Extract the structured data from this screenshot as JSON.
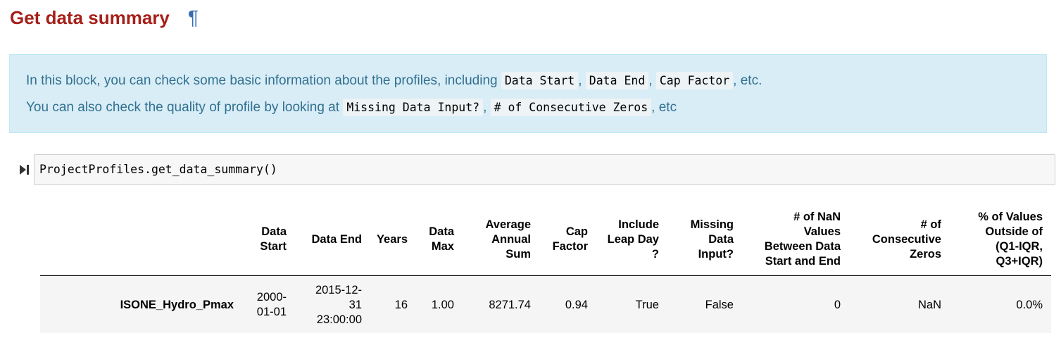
{
  "heading": {
    "title": "Get data summary",
    "anchor": "¶"
  },
  "info": {
    "line1_prefix": "In this block, you can check some basic information about the profiles, including",
    "line1_code1": "Data Start",
    "line1_sep1": ",",
    "line1_code2": "Data End",
    "line1_sep2": ",",
    "line1_code3": "Cap Factor",
    "line1_suffix": ", etc.",
    "line2_prefix": "You can also check the quality of profile by looking at",
    "line2_code1": "Missing Data Input?",
    "line2_sep1": ",",
    "line2_code2": "# of Consecutive Zeros",
    "line2_suffix": ", etc"
  },
  "cell": {
    "code": "ProjectProfiles.get_data_summary()"
  },
  "table": {
    "headers": {
      "data_start": [
        "Data",
        "Start"
      ],
      "data_end": [
        "Data End"
      ],
      "years": [
        "Years"
      ],
      "data_max": [
        "Data",
        "Max"
      ],
      "avg_annual_sum": [
        "Average",
        "Annual",
        "Sum"
      ],
      "cap_factor": [
        "Cap",
        "Factor"
      ],
      "include_leap_day": [
        "Include",
        "Leap Day",
        "?"
      ],
      "missing_data_input": [
        "Missing",
        "Data",
        "Input?"
      ],
      "nan_values": [
        "# of NaN",
        "Values",
        "Between Data",
        "Start and End"
      ],
      "consecutive_zeros": [
        "# of",
        "Consecutive",
        "Zeros"
      ],
      "pct_outside": [
        "% of Values",
        "Outside of",
        "(Q1-IQR,",
        "Q3+IQR)"
      ]
    },
    "row": {
      "index": "ISONE_Hydro_Pmax",
      "data_start": [
        "2000-",
        "01-01"
      ],
      "data_end": [
        "2015-12-",
        "31",
        "23:00:00"
      ],
      "years": "16",
      "data_max": "1.00",
      "avg_annual_sum": "8271.74",
      "cap_factor": "0.94",
      "include_leap_day": "True",
      "missing_data_input": "False",
      "nan_values": "0",
      "consecutive_zeros": "NaN",
      "pct_outside": "0.0%"
    }
  }
}
